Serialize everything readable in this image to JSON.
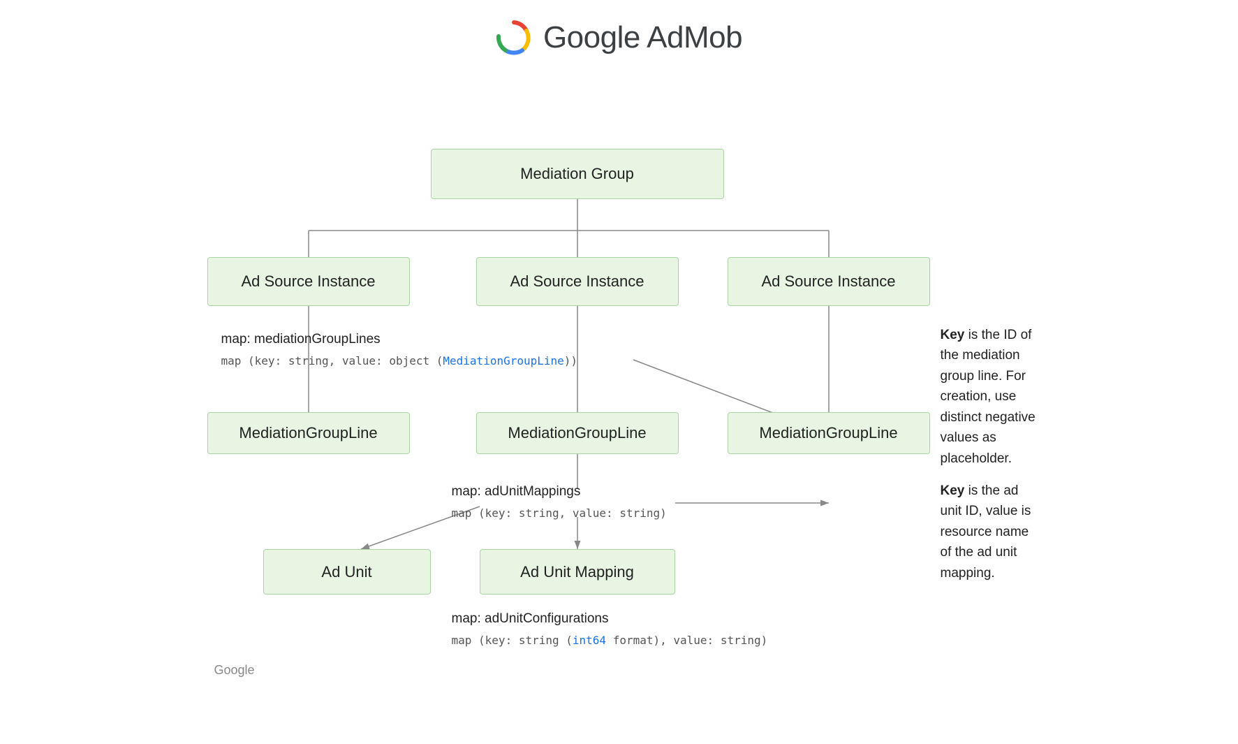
{
  "header": {
    "title": "Google AdMob"
  },
  "boxes": {
    "mediation_group": "Mediation Group",
    "ad_source_1": "Ad Source Instance",
    "ad_source_2": "Ad Source Instance",
    "ad_source_3": "Ad Source Instance",
    "mediation_line_1": "MediationGroupLine",
    "mediation_line_2": "MediationGroupLine",
    "mediation_line_3": "MediationGroupLine",
    "ad_unit": "Ad Unit",
    "ad_unit_mapping": "Ad Unit Mapping"
  },
  "annotations": {
    "map_mediation_label": "map: mediationGroupLines",
    "map_mediation_code": "map (key: string, value: object (MediationGroupLine))",
    "map_mediation_link": "MediationGroupLine",
    "map_mediation_note_bold": "Key",
    "map_mediation_note_text": " is the ID of the mediation group line. For creation, use distinct negative values as placeholder.",
    "map_adunit_label": "map: adUnitMappings",
    "map_adunit_code": "map (key: string, value: string)",
    "map_adunit_note_bold": "Key",
    "map_adunit_note_text": " is the ad unit ID, value is resource name of the ad unit mapping.",
    "map_config_label": "map: adUnitConfigurations",
    "map_config_code": "map (key: string (int64 format), value: string)",
    "map_config_link": "int64"
  }
}
